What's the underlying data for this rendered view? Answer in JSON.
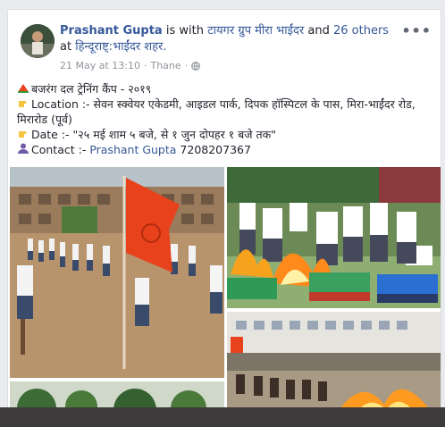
{
  "post": {
    "author": "Prashant Gupta",
    "with_text": "is with",
    "tagged_group": "टायगर ग्रुप मीरा भाईंदर",
    "and_text": "and",
    "others": "26 others",
    "at_text": "at",
    "location": "हिन्दूराष्ट्:भाईंदर शहर.",
    "date": "21 May at 13:10",
    "place": "Thane",
    "more_icon": "more-options-icon"
  },
  "content": {
    "line1": "बजरंग दल ट्रेनिंग कैंप - २०१९",
    "line2": "Location :- सेवन स्क्वेयर एकेडमी, आइडल पार्क, दिपक हॉस्पिटल के पास, मिरा-भाईंदर रोड, मिरारोड (पूर्व)",
    "line3": "Date :- \"२५ मई शाम ५ बजे, से १ जुन दोपहर १ बजे तक\"",
    "line4_prefix": "Contact :-",
    "contact_name": "Prashant Gupta",
    "contact_phone": "7208207367"
  },
  "icons": {
    "line1": "camp-icon",
    "line2": "pointing-hand-icon",
    "line3": "pointing-hand-icon",
    "line4": "person-icon"
  },
  "colors": {
    "link": "#365899",
    "flag": "#e8421c",
    "bottom_bar": "#3d3a3b"
  }
}
